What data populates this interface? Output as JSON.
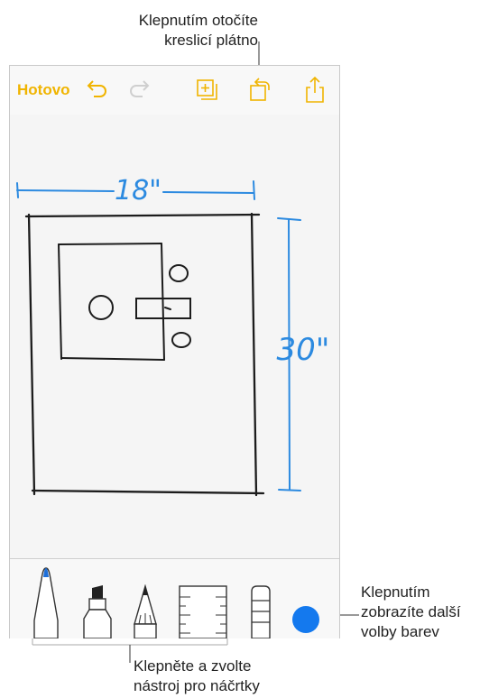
{
  "callouts": {
    "rotate": [
      "Klepnutím otočíte",
      "kreslicí plátno"
    ],
    "colors": [
      "Klepnutím",
      "zobrazíte další",
      "volby barev"
    ],
    "tools": [
      "Klepněte a zvolte",
      "nástroj pro náčrtky"
    ]
  },
  "toolbar": {
    "done_label": "Hotovo",
    "icons": [
      "undo-icon",
      "redo-icon",
      "add-drawing-icon",
      "rotate-canvas-icon",
      "share-icon"
    ]
  },
  "sketch": {
    "width_label": "18\"",
    "height_label": "30\""
  },
  "tools": [
    "pen-tool",
    "marker-tool",
    "pencil-tool",
    "ruler-tool",
    "eraser-tool"
  ],
  "colors": {
    "accent": "#f0b400",
    "sketch_blue": "#2c8ae0",
    "ink": "#1c1c1c",
    "selected_color": "#1479ee"
  }
}
